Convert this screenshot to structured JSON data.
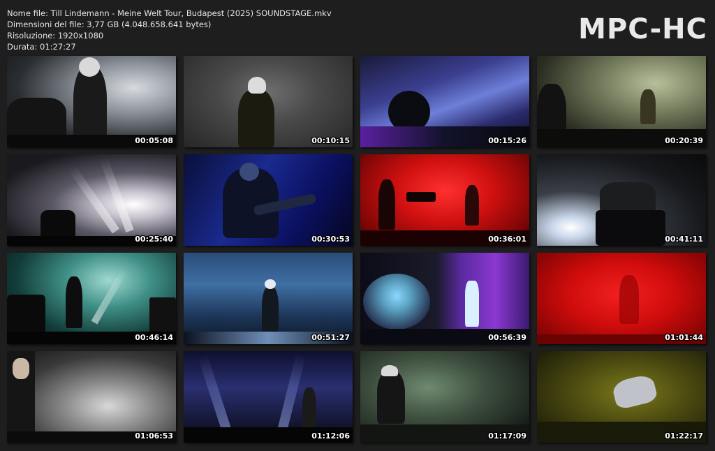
{
  "info": {
    "file_name": "Nome file: Till Lindemann - Meine Welt Tour, Budapest (2025) SOUNDSTAGE.mkv",
    "file_size": "Dimensioni del file: 3,77 GB (4.048.658.641 bytes)",
    "resolution": "Risoluzione: 1920x1080",
    "duration": "Durata: 01:27:27"
  },
  "logo": "MPC-HC",
  "thumbnails": [
    {
      "time": "00:05:08",
      "scene": "gray-crowd"
    },
    {
      "time": "00:10:15",
      "scene": "gray-smoke-singer"
    },
    {
      "time": "00:15:26",
      "scene": "purple-blue-smoke"
    },
    {
      "time": "00:20:39",
      "scene": "green-stage-band"
    },
    {
      "time": "00:25:40",
      "scene": "white-beams-stage"
    },
    {
      "time": "00:30:53",
      "scene": "blue-guitarist"
    },
    {
      "time": "00:36:01",
      "scene": "red-stage-band"
    },
    {
      "time": "00:41:11",
      "scene": "dark-drums-light"
    },
    {
      "time": "00:46:14",
      "scene": "teal-beams-singer"
    },
    {
      "time": "00:51:27",
      "scene": "blue-walkway-singer"
    },
    {
      "time": "00:56:39",
      "scene": "bubble-purple-stage"
    },
    {
      "time": "01:01:44",
      "scene": "red-fog"
    },
    {
      "time": "01:06:53",
      "scene": "gray-boots-stage"
    },
    {
      "time": "01:12:06",
      "scene": "purple-beams-singer"
    },
    {
      "time": "01:17:09",
      "scene": "green-guitarist"
    },
    {
      "time": "01:22:17",
      "scene": "yellow-dancer"
    }
  ]
}
